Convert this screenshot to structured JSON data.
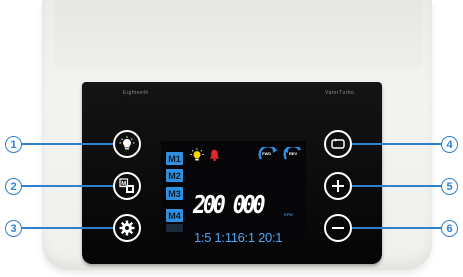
{
  "device": {
    "brand_left": "Eighteeth",
    "brand_right": "VaterTurbo"
  },
  "left_buttons": [
    {
      "callout": "1",
      "icon": "light-bulb-icon"
    },
    {
      "callout": "2",
      "icon": "memory-mode-icon"
    },
    {
      "callout": "3",
      "icon": "gear-icon"
    }
  ],
  "right_buttons": [
    {
      "callout": "4",
      "icon": "direction-toggle-icon"
    },
    {
      "callout": "5",
      "icon": "plus-icon"
    },
    {
      "callout": "6",
      "icon": "minus-icon"
    }
  ],
  "display": {
    "modes": [
      "M1",
      "M2",
      "M3",
      "M4"
    ],
    "forward_label": "FWD",
    "reverse_label": "REV",
    "speed": "200 000",
    "speed_unit": "RPM",
    "ratios": "1:5 1:116:1 20:1",
    "accent_color": "#2f8fe0",
    "alarm_color": "#e02a2a",
    "light_color": "#f5d400"
  }
}
